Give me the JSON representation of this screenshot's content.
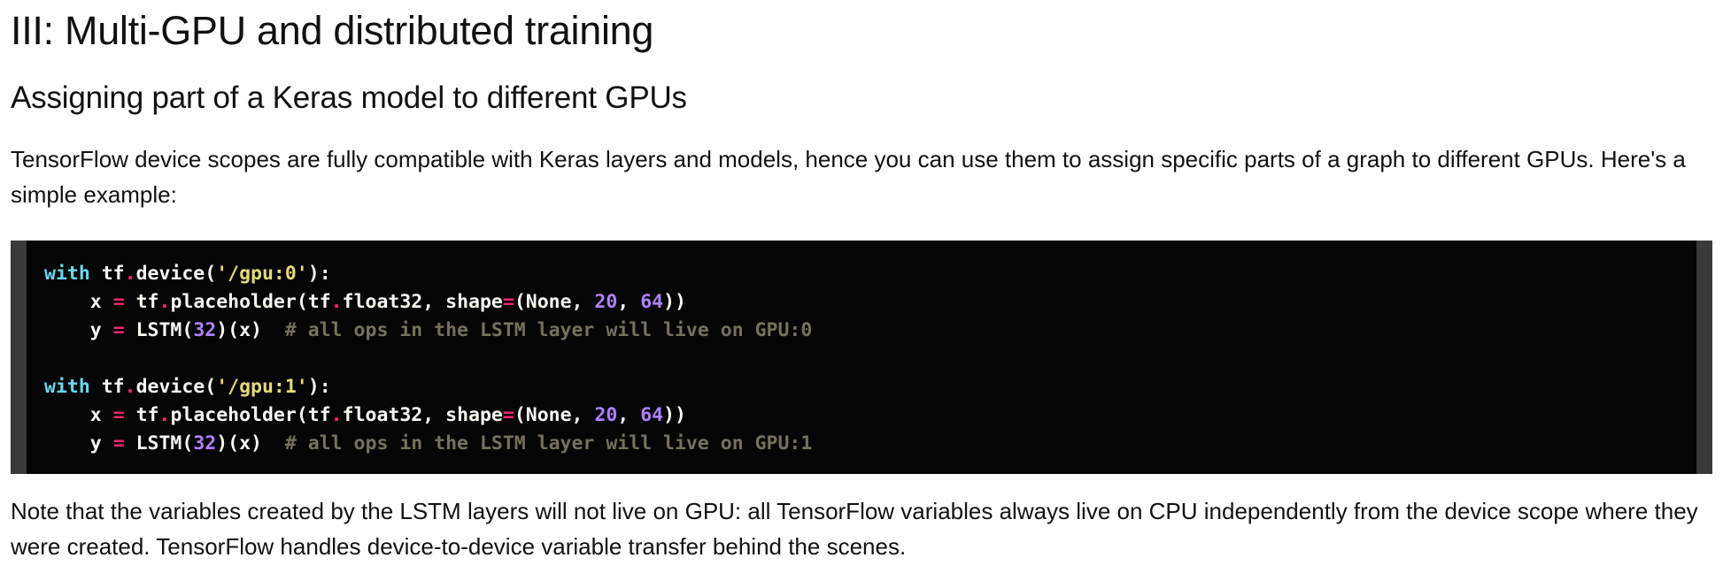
{
  "headings": {
    "section": "III: Multi-GPU and distributed training",
    "subsection": "Assigning part of a Keras model to different GPUs"
  },
  "paragraphs": {
    "intro": "TensorFlow device scopes are fully compatible with Keras layers and models, hence you can use them to assign specific parts of a graph to different GPUs. Here's a simple example:",
    "note": "Note that the variables created by the LSTM layers will not live on GPU: all TensorFlow variables always live on CPU independently from the device scope where they were created. TensorFlow handles device-to-device variable transfer behind the scenes."
  },
  "code": {
    "blocks": [
      {
        "device": "'/gpu:0'",
        "comment": "# all ops in the LSTM layer will live on GPU:0"
      },
      {
        "device": "'/gpu:1'",
        "comment": "# all ops in the LSTM layer will live on GPU:1"
      }
    ],
    "tokens": {
      "with": "with",
      "tf": "tf",
      "dot": ".",
      "device_call": "device(",
      "close_colon": "):",
      "x": "x",
      "y": "y",
      "eq": "=",
      "placeholder_call": "placeholder(",
      "float32": "float32, ",
      "shape": "shape",
      "none": "(None, ",
      "n20": "20",
      "comma": ", ",
      "n64": "64",
      "close_parens": "))",
      "lstm_open": "LSTM(",
      "n32": "32",
      "lstm_close": ")(x)"
    }
  },
  "colors": {
    "keyword": "#66d9ef",
    "operator": "#f92672",
    "string": "#e6db74",
    "number": "#ae81ff",
    "comment": "#75715e",
    "code_background": "#050505"
  }
}
